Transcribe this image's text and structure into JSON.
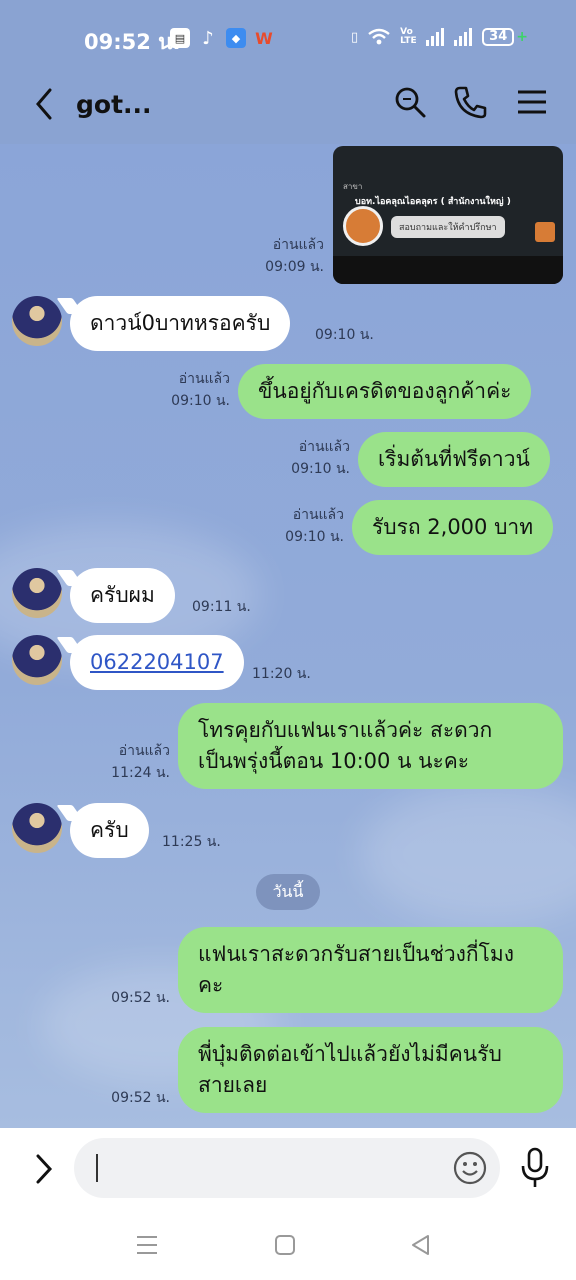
{
  "status_bar": {
    "time": "09:52 น.",
    "battery": "34",
    "volte": "Vo LTE"
  },
  "header": {
    "title": "got..."
  },
  "image_message": {
    "caption_location": "สาขา",
    "caption_name": "บอท.ไอคลุณไอคลุดร ( สำนักงานใหญ่ )",
    "caption_button": "สอบถามและให้คำปรึกษา",
    "read": "อ่านแล้ว",
    "time": "09:09 น."
  },
  "messages": [
    {
      "text": "ดาวน์0บาทหรอครับ",
      "time": "09:10 น."
    },
    {
      "text": "ขึ้นอยู่กับเครดิตของลูกค้าค่ะ",
      "read": "อ่านแล้ว",
      "time": "09:10 น."
    },
    {
      "text": "เริ่มต้นที่ฟรีดาวน์",
      "read": "อ่านแล้ว",
      "time": "09:10 น."
    },
    {
      "text": "รับรถ 2,000 บาท",
      "read": "อ่านแล้ว",
      "time": "09:10 น."
    },
    {
      "text": "ครับผม",
      "time": "09:11 น."
    },
    {
      "text": "0622204107",
      "time": "11:20 น."
    },
    {
      "text": "โทรคุยกับแฟนเราแล้วค่ะ สะดวก\nเป็นพรุ่งนี้ตอน 10:00 น นะคะ",
      "read": "อ่านแล้ว",
      "time": "11:24 น."
    },
    {
      "text": "ครับ",
      "time": "11:25 น."
    },
    {
      "text": "แฟนเราสะดวกรับสายเป็นช่วงกี่โมง\nคะ",
      "time": "09:52 น."
    },
    {
      "text": "พี่บุ๋มติดต่อเข้าไปแล้วยังไม่มีคนรับ\nสายเลย",
      "time": "09:52 น."
    }
  ],
  "date_separator": "วันนี้",
  "input": {
    "placeholder": ""
  }
}
